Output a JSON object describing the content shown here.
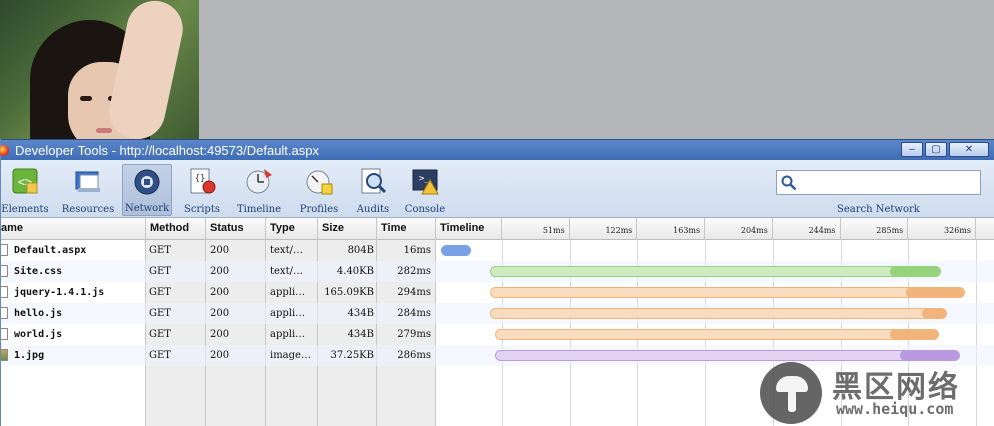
{
  "window": {
    "title": "Developer Tools - http://localhost:49573/Default.aspx",
    "buttons": [
      "–",
      "▢",
      "✕"
    ]
  },
  "toolbar": {
    "tools": [
      {
        "label": "Elements",
        "icon": "elements-icon"
      },
      {
        "label": "Resources",
        "icon": "resources-icon"
      },
      {
        "label": "Network",
        "icon": "network-icon",
        "active": true
      },
      {
        "label": "Scripts",
        "icon": "scripts-icon"
      },
      {
        "label": "Timeline",
        "icon": "timeline-icon"
      },
      {
        "label": "Profiles",
        "icon": "profiles-icon"
      },
      {
        "label": "Audits",
        "icon": "audits-icon"
      },
      {
        "label": "Console",
        "icon": "console-icon"
      }
    ],
    "search": {
      "value": "",
      "caption": "Search Network"
    }
  },
  "network": {
    "columns": [
      "ame",
      "Method",
      "Status",
      "Type",
      "Size",
      "Time",
      "Timeline"
    ],
    "ticks": [
      "51ms",
      "122ms",
      "163ms",
      "204ms",
      "244ms",
      "285ms",
      "326ms"
    ],
    "rows": [
      {
        "name": "Default.aspx",
        "method": "GET",
        "status": "200",
        "type": "text/…",
        "size": "804B",
        "time": "16ms",
        "color": "#8fb3ec",
        "recv_color": "#7aa1e6",
        "start": 0.0,
        "latency_end": 0.0,
        "end": 0.055
      },
      {
        "name": "Site.css",
        "method": "GET",
        "status": "200",
        "type": "text/…",
        "size": "4.40KB",
        "time": "282ms",
        "color": "#cdeac0",
        "recv_color": "#96d37d",
        "start": 0.09,
        "latency_end": 0.84,
        "end": 0.935
      },
      {
        "name": "jquery-1.4.1.js",
        "method": "GET",
        "status": "200",
        "type": "appli…",
        "size": "165.09KB",
        "time": "294ms",
        "color": "#f8dcbd",
        "recv_color": "#f2b47a",
        "start": 0.09,
        "latency_end": 0.87,
        "end": 0.98
      },
      {
        "name": "hello.js",
        "method": "GET",
        "status": "200",
        "type": "appli…",
        "size": "434B",
        "time": "284ms",
        "color": "#f8dcbd",
        "recv_color": "#f2b47a",
        "start": 0.09,
        "latency_end": 0.9,
        "end": 0.945
      },
      {
        "name": "world.js",
        "method": "GET",
        "status": "200",
        "type": "appli…",
        "size": "434B",
        "time": "279ms",
        "color": "#f8dcbd",
        "recv_color": "#f2b47a",
        "start": 0.1,
        "latency_end": 0.84,
        "end": 0.93
      },
      {
        "name": "1.jpg",
        "method": "GET",
        "status": "200",
        "type": "image…",
        "size": "37.25KB",
        "time": "286ms",
        "color": "#e3d3f0",
        "recv_color": "#b99ae0",
        "start": 0.1,
        "latency_end": 0.86,
        "end": 0.97
      }
    ]
  },
  "watermark": {
    "chinese": "黑区网络",
    "url": "www.heiqu.com"
  }
}
